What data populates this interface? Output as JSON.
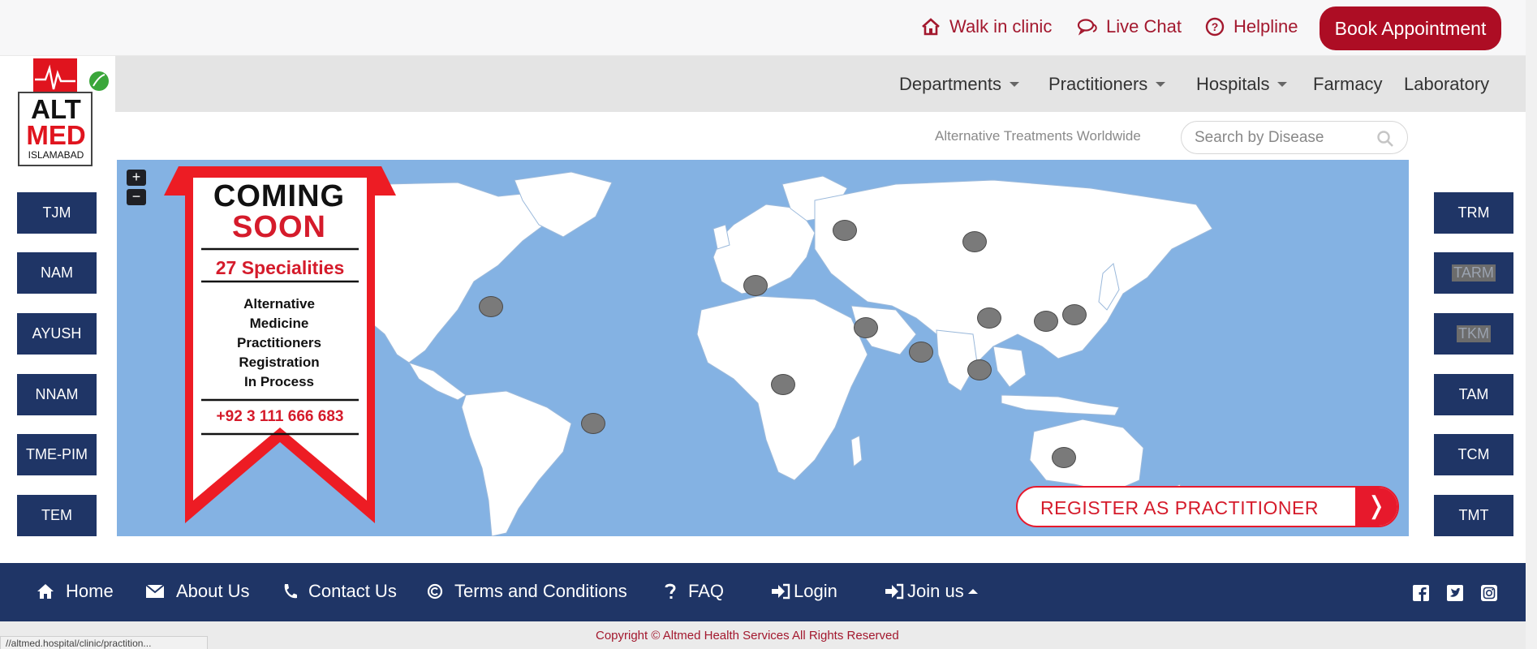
{
  "topbar": {
    "walk_in": "Walk in clinic",
    "live_chat": "Live Chat",
    "helpline": "Helpline",
    "book": "Book Appointment"
  },
  "logo": {
    "line1": "ALT",
    "line2": "MED",
    "city": "ISLAMABAD"
  },
  "nav": {
    "departments": "Departments",
    "practitioners": "Practitioners",
    "hospitals": "Hospitals",
    "farmacy": "Farmacy",
    "laboratory": "Laboratory"
  },
  "search": {
    "tagline": "Alternative Treatments Worldwide",
    "placeholder": "Search by Disease"
  },
  "left_buttons": [
    "TJM",
    "NAM",
    "AYUSH",
    "NNAM",
    "TME-PIM",
    "TEM"
  ],
  "right_buttons": [
    "TRM",
    "TARM",
    "TKM",
    "TAM",
    "TCM",
    "TMT"
  ],
  "map": {
    "zoom_in": "+",
    "zoom_out": "−",
    "banner": {
      "coming": "COMING",
      "soon": "SOON",
      "specialities": "27 Specialities",
      "desc1": "Alternative",
      "desc2": "Medicine",
      "desc3": "Practitioners",
      "desc4": "Registration",
      "desc5": "In Process",
      "phone": "+92 3 111 666 683"
    },
    "register": "REGISTER AS PRACTITIONER",
    "register_arrow": "❭"
  },
  "footer": {
    "home": "Home",
    "about": "About Us",
    "contact": "Contact Us",
    "terms": "Terms and Conditions",
    "faq": "FAQ",
    "login": "Login",
    "join": "Join us"
  },
  "copyright": "Copyright © Altmed Health Services All Rights Reserved",
  "status_url": "//altmed.hospital/clinic/practition...",
  "colors": {
    "brand_red": "#ad0d24",
    "navy": "#1f3566",
    "map_sea": "#84b2e3"
  }
}
